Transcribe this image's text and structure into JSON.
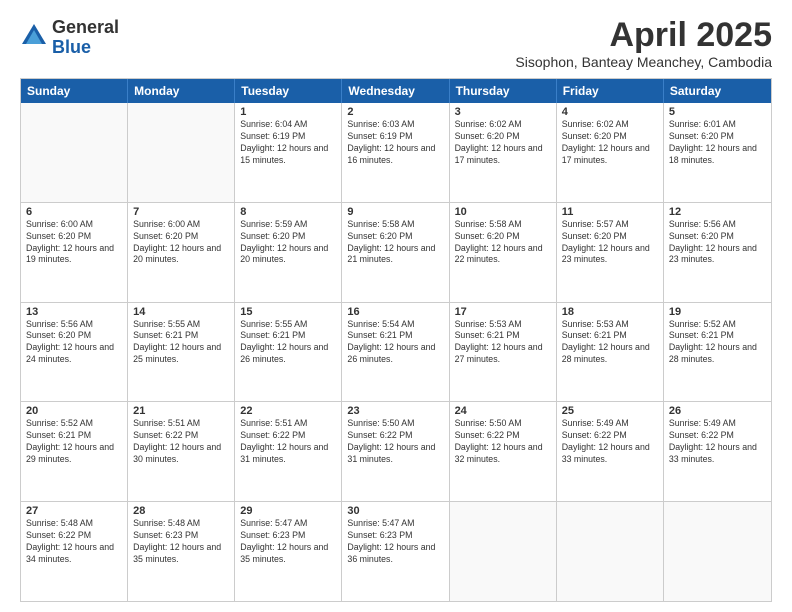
{
  "logo": {
    "general": "General",
    "blue": "Blue"
  },
  "header": {
    "month": "April 2025",
    "location": "Sisophon, Banteay Meanchey, Cambodia"
  },
  "dayHeaders": [
    "Sunday",
    "Monday",
    "Tuesday",
    "Wednesday",
    "Thursday",
    "Friday",
    "Saturday"
  ],
  "weeks": [
    [
      {
        "day": "",
        "empty": true
      },
      {
        "day": "",
        "empty": true
      },
      {
        "day": "1",
        "sunrise": "6:04 AM",
        "sunset": "6:19 PM",
        "daylight": "12 hours and 15 minutes."
      },
      {
        "day": "2",
        "sunrise": "6:03 AM",
        "sunset": "6:19 PM",
        "daylight": "12 hours and 16 minutes."
      },
      {
        "day": "3",
        "sunrise": "6:02 AM",
        "sunset": "6:20 PM",
        "daylight": "12 hours and 17 minutes."
      },
      {
        "day": "4",
        "sunrise": "6:02 AM",
        "sunset": "6:20 PM",
        "daylight": "12 hours and 17 minutes."
      },
      {
        "day": "5",
        "sunrise": "6:01 AM",
        "sunset": "6:20 PM",
        "daylight": "12 hours and 18 minutes."
      }
    ],
    [
      {
        "day": "6",
        "sunrise": "6:00 AM",
        "sunset": "6:20 PM",
        "daylight": "12 hours and 19 minutes."
      },
      {
        "day": "7",
        "sunrise": "6:00 AM",
        "sunset": "6:20 PM",
        "daylight": "12 hours and 20 minutes."
      },
      {
        "day": "8",
        "sunrise": "5:59 AM",
        "sunset": "6:20 PM",
        "daylight": "12 hours and 20 minutes."
      },
      {
        "day": "9",
        "sunrise": "5:58 AM",
        "sunset": "6:20 PM",
        "daylight": "12 hours and 21 minutes."
      },
      {
        "day": "10",
        "sunrise": "5:58 AM",
        "sunset": "6:20 PM",
        "daylight": "12 hours and 22 minutes."
      },
      {
        "day": "11",
        "sunrise": "5:57 AM",
        "sunset": "6:20 PM",
        "daylight": "12 hours and 23 minutes."
      },
      {
        "day": "12",
        "sunrise": "5:56 AM",
        "sunset": "6:20 PM",
        "daylight": "12 hours and 23 minutes."
      }
    ],
    [
      {
        "day": "13",
        "sunrise": "5:56 AM",
        "sunset": "6:20 PM",
        "daylight": "12 hours and 24 minutes."
      },
      {
        "day": "14",
        "sunrise": "5:55 AM",
        "sunset": "6:21 PM",
        "daylight": "12 hours and 25 minutes."
      },
      {
        "day": "15",
        "sunrise": "5:55 AM",
        "sunset": "6:21 PM",
        "daylight": "12 hours and 26 minutes."
      },
      {
        "day": "16",
        "sunrise": "5:54 AM",
        "sunset": "6:21 PM",
        "daylight": "12 hours and 26 minutes."
      },
      {
        "day": "17",
        "sunrise": "5:53 AM",
        "sunset": "6:21 PM",
        "daylight": "12 hours and 27 minutes."
      },
      {
        "day": "18",
        "sunrise": "5:53 AM",
        "sunset": "6:21 PM",
        "daylight": "12 hours and 28 minutes."
      },
      {
        "day": "19",
        "sunrise": "5:52 AM",
        "sunset": "6:21 PM",
        "daylight": "12 hours and 28 minutes."
      }
    ],
    [
      {
        "day": "20",
        "sunrise": "5:52 AM",
        "sunset": "6:21 PM",
        "daylight": "12 hours and 29 minutes."
      },
      {
        "day": "21",
        "sunrise": "5:51 AM",
        "sunset": "6:22 PM",
        "daylight": "12 hours and 30 minutes."
      },
      {
        "day": "22",
        "sunrise": "5:51 AM",
        "sunset": "6:22 PM",
        "daylight": "12 hours and 31 minutes."
      },
      {
        "day": "23",
        "sunrise": "5:50 AM",
        "sunset": "6:22 PM",
        "daylight": "12 hours and 31 minutes."
      },
      {
        "day": "24",
        "sunrise": "5:50 AM",
        "sunset": "6:22 PM",
        "daylight": "12 hours and 32 minutes."
      },
      {
        "day": "25",
        "sunrise": "5:49 AM",
        "sunset": "6:22 PM",
        "daylight": "12 hours and 33 minutes."
      },
      {
        "day": "26",
        "sunrise": "5:49 AM",
        "sunset": "6:22 PM",
        "daylight": "12 hours and 33 minutes."
      }
    ],
    [
      {
        "day": "27",
        "sunrise": "5:48 AM",
        "sunset": "6:22 PM",
        "daylight": "12 hours and 34 minutes."
      },
      {
        "day": "28",
        "sunrise": "5:48 AM",
        "sunset": "6:23 PM",
        "daylight": "12 hours and 35 minutes."
      },
      {
        "day": "29",
        "sunrise": "5:47 AM",
        "sunset": "6:23 PM",
        "daylight": "12 hours and 35 minutes."
      },
      {
        "day": "30",
        "sunrise": "5:47 AM",
        "sunset": "6:23 PM",
        "daylight": "12 hours and 36 minutes."
      },
      {
        "day": "",
        "empty": true
      },
      {
        "day": "",
        "empty": true
      },
      {
        "day": "",
        "empty": true
      }
    ]
  ]
}
